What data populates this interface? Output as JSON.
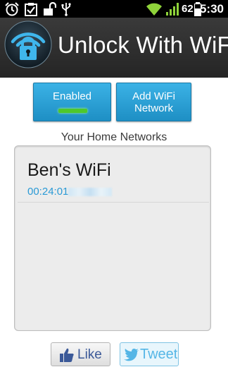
{
  "status_bar": {
    "icons": [
      "alarm-icon",
      "clipboard-check-icon",
      "unlock-icon",
      "usb-icon",
      "wifi-signal-icon",
      "cell-signal-icon",
      "battery-icon"
    ],
    "battery_percent": "62",
    "time": "5:30"
  },
  "header": {
    "title": "Unlock With WiFi",
    "logo_icon": "wifi-lock-logo-icon"
  },
  "actions": {
    "enabled_label": "Enabled",
    "enabled_state": true,
    "add_network_label": "Add WiFi Network"
  },
  "networks": {
    "section_title": "Your Home Networks",
    "items": [
      {
        "name": "Ben's WiFi",
        "mac_visible": "00:24:01"
      }
    ]
  },
  "social": {
    "like_label": "Like",
    "tweet_label": "Tweet"
  },
  "colors": {
    "accent_blue": "#2b9fd8",
    "indicator_green": "#4ec82c",
    "mac_text": "#2a9ad6",
    "header_bg": "#2f2f2f"
  }
}
